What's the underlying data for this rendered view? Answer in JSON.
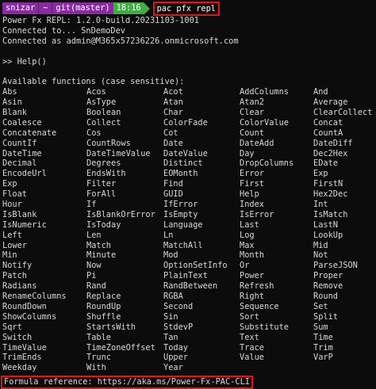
{
  "prompt": {
    "user": "snizar",
    "cwd": "~",
    "branch": "git(master)",
    "time": "18:16",
    "command": "pac pfx repl"
  },
  "output": {
    "line1": "Power Fx REPL: 1.2.0-build.20231103-1001",
    "line2": "Connected to... SnDemoDev",
    "line3": "Connected as admin@M365x57236226.onmicrosoft.com",
    "help_cmd": ">> Help()",
    "available": "Available functions (case sensitive):"
  },
  "functions": [
    [
      "Abs",
      "Acos",
      "Acot",
      "AddColumns",
      "And"
    ],
    [
      "Asin",
      "AsType",
      "Atan",
      "Atan2",
      "Average"
    ],
    [
      "Blank",
      "Boolean",
      "Char",
      "Clear",
      "ClearCollect"
    ],
    [
      "Coalesce",
      "Collect",
      "ColorFade",
      "ColorValue",
      "Concat"
    ],
    [
      "Concatenate",
      "Cos",
      "Cot",
      "Count",
      "CountA"
    ],
    [
      "CountIf",
      "CountRows",
      "Date",
      "DateAdd",
      "DateDiff"
    ],
    [
      "DateTime",
      "DateTimeValue",
      "DateValue",
      "Day",
      "Dec2Hex"
    ],
    [
      "Decimal",
      "Degrees",
      "Distinct",
      "DropColumns",
      "EDate"
    ],
    [
      "EncodeUrl",
      "EndsWith",
      "EOMonth",
      "Error",
      "Exp"
    ],
    [
      "Exp",
      "Filter",
      "Find",
      "First",
      "FirstN"
    ],
    [
      "Float",
      "ForAll",
      "GUID",
      "Help",
      "Hex2Dec"
    ],
    [
      "Hour",
      "If",
      "IfError",
      "Index",
      "Int"
    ],
    [
      "IsBlank",
      "IsBlankOrError",
      "IsEmpty",
      "IsError",
      "IsMatch"
    ],
    [
      "IsNumeric",
      "IsToday",
      "Language",
      "Last",
      "LastN"
    ],
    [
      "Left",
      "Len",
      "Ln",
      "Log",
      "LookUp"
    ],
    [
      "Lower",
      "Match",
      "MatchAll",
      "Max",
      "Mid"
    ],
    [
      "Min",
      "Minute",
      "Mod",
      "Month",
      "Not"
    ],
    [
      "Notify",
      "Now",
      "OptionSetInfo",
      "Or",
      "ParseJSON"
    ],
    [
      "Patch",
      "Pi",
      "PlainText",
      "Power",
      "Proper"
    ],
    [
      "Radians",
      "Rand",
      "RandBetween",
      "Refresh",
      "Remove"
    ],
    [
      "RenameColumns",
      "Replace",
      "RGBA",
      "Right",
      "Round"
    ],
    [
      "RoundDown",
      "RoundUp",
      "Second",
      "Sequence",
      "Set"
    ],
    [
      "ShowColumns",
      "Shuffle",
      "Sin",
      "Sort",
      "Split"
    ],
    [
      "Sqrt",
      "StartsWith",
      "StdevP",
      "Substitute",
      "Sum"
    ],
    [
      "Switch",
      "Table",
      "Tan",
      "Text",
      "Time"
    ],
    [
      "TimeValue",
      "TimeZoneOffset",
      "Today",
      "Trace",
      "Trim"
    ],
    [
      "TrimEnds",
      "Trunc",
      "Upper",
      "Value",
      "VarP"
    ],
    [
      "Weekday",
      "With",
      "Year",
      "",
      ""
    ]
  ],
  "footer": {
    "formula": "Formula reference: https://aka.ms/Power-Fx-PAC-CLI"
  }
}
